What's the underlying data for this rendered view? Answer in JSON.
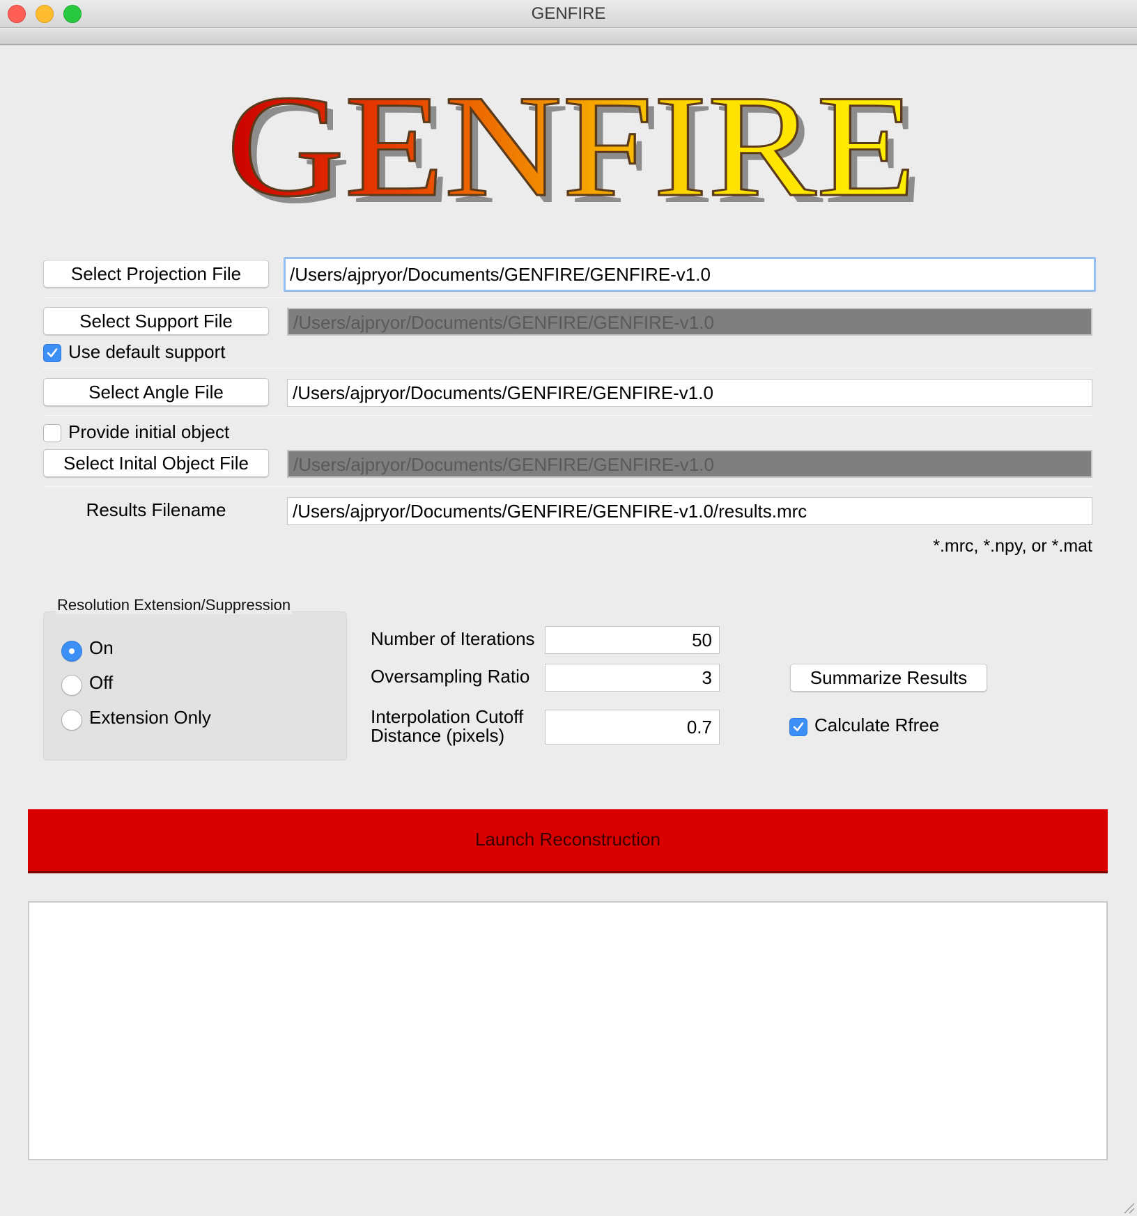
{
  "window": {
    "title": "GENFIRE"
  },
  "logo": {
    "text": "GENFIRE"
  },
  "projection": {
    "button_label": "Select Projection File",
    "path": "/Users/ajpryor/Documents/GENFIRE/GENFIRE-v1.0"
  },
  "support": {
    "button_label": "Select Support File",
    "path": "/Users/ajpryor/Documents/GENFIRE/GENFIRE-v1.0",
    "default_label": "Use default support",
    "default_checked": true
  },
  "angle": {
    "button_label": "Select Angle File",
    "path": "/Users/ajpryor/Documents/GENFIRE/GENFIRE-v1.0"
  },
  "initial_object": {
    "checkbox_label": "Provide initial object",
    "checked": false,
    "button_label": "Select Inital Object File",
    "path": "/Users/ajpryor/Documents/GENFIRE/GENFIRE-v1.0"
  },
  "results": {
    "label": "Results Filename",
    "path": "/Users/ajpryor/Documents/GENFIRE/GENFIRE-v1.0/results.mrc",
    "hint": "*.mrc, *.npy, or *.mat"
  },
  "resolution": {
    "title": "Resolution Extension/Suppression",
    "options": [
      "On",
      "Off",
      "Extension Only"
    ],
    "selected": "On"
  },
  "params": {
    "iterations_label": "Number of Iterations",
    "iterations": "50",
    "oversampling_label": "Oversampling Ratio",
    "oversampling": "3",
    "cutoff_label_1": "Interpolation Cutoff",
    "cutoff_label_2": "Distance (pixels)",
    "cutoff": "0.7"
  },
  "summarize_label": "Summarize Results",
  "rfree": {
    "label": "Calculate Rfree",
    "checked": true
  },
  "launch_label": "Launch Reconstruction",
  "log_text": "",
  "colors": {
    "launch": "#d90000",
    "focus_ring": "#93bff1",
    "checkbox": "#3b8ff5",
    "logo_start": "#d80000",
    "logo_end": "#ffee00"
  }
}
